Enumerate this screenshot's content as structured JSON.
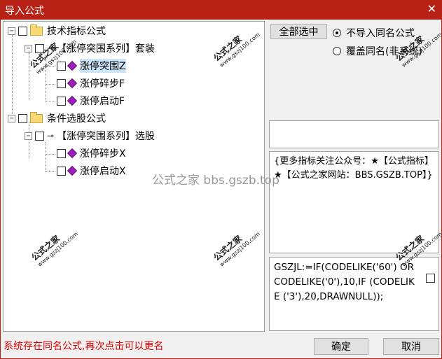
{
  "window": {
    "title": "导入公式",
    "close_glyph": "✕"
  },
  "tree": {
    "groups": [
      {
        "label": "技术指标公式",
        "expander": "−",
        "subgroup": {
          "label": "【涨停突围系列】套装",
          "expander": "−",
          "items": [
            {
              "label": "涨停突围Z"
            },
            {
              "label": "涨停碎步F"
            },
            {
              "label": "涨停启动F"
            }
          ]
        }
      },
      {
        "label": "条件选股公式",
        "expander": "−",
        "subgroup": {
          "label": "【涨停突围系列】选股",
          "expander": "−",
          "items": [
            {
              "label": "涨停碎步X"
            },
            {
              "label": "涨停启动X"
            }
          ]
        }
      }
    ]
  },
  "options": {
    "select_all_label": "全部选中",
    "skip_same_label": "不导入同名公式",
    "overwrite_label": "覆盖同名(非系统)"
  },
  "description": "{更多指标关注公众号：★【公式指标】★【公式之家网站：BBS.GSZB.TOP】}",
  "code": "GSZJL:=IF(CODELIKE('60') OR CODELIKE('0'),10,IF (CODELIKE ('3'),20,DRAWNULL));",
  "status_message": "系统存在同名公式,再次点击可以更名",
  "buttons": {
    "ok": "确定",
    "cancel": "取消"
  },
  "watermark": {
    "brand": "公式之家",
    "site": "www.gszj100.com",
    "center_text": "公式之家 bbs.gszb.top"
  },
  "colors": {
    "titlebar": "#b82216",
    "status": "#e00000",
    "item_icon": "#9b1fb4",
    "folder": "#f7d873"
  }
}
